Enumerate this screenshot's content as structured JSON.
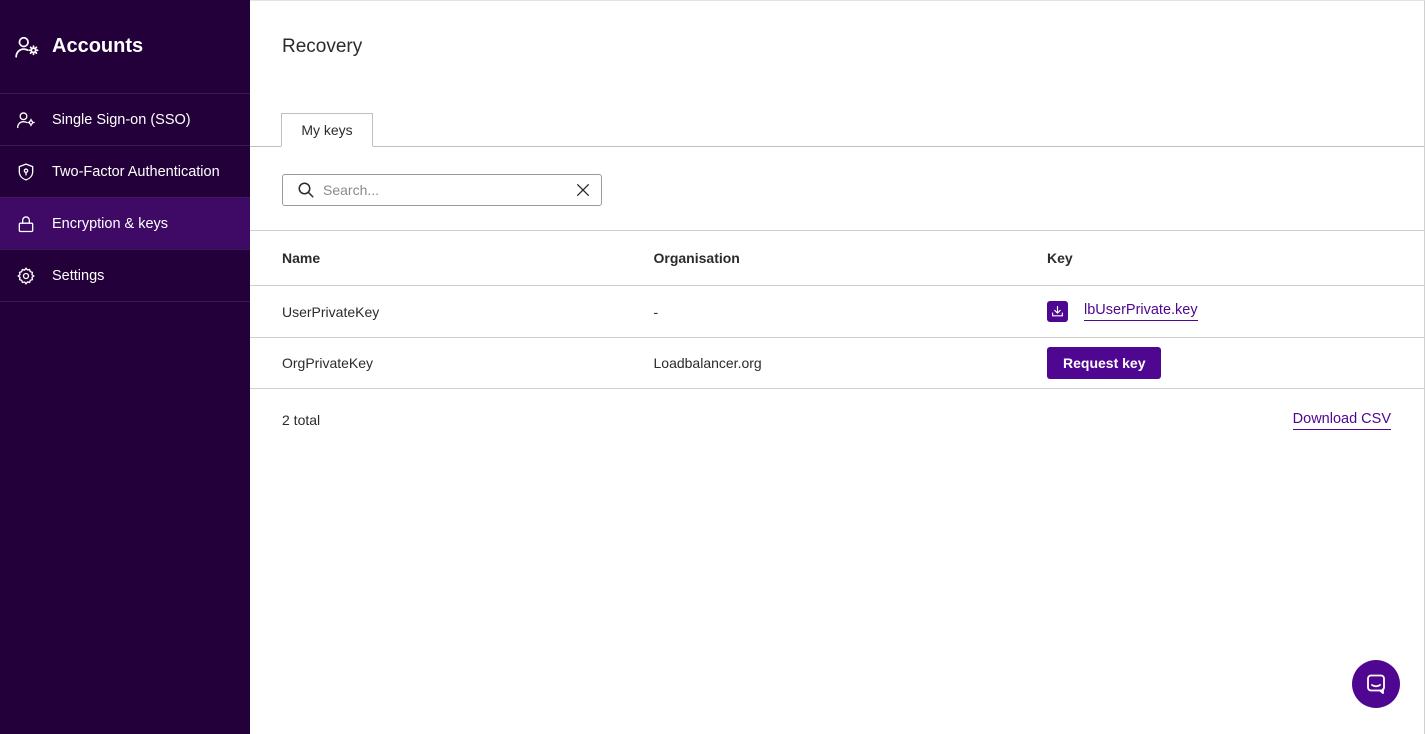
{
  "sidebar": {
    "title": "Accounts",
    "title_icon": "user-cog-icon",
    "items": [
      {
        "label": "Single Sign-on (SSO)",
        "icon": "user-cog-icon",
        "active": false
      },
      {
        "label": "Two-Factor Authentication",
        "icon": "shield-icon",
        "active": false
      },
      {
        "label": "Encryption & keys",
        "icon": "lock-icon",
        "active": true
      },
      {
        "label": "Settings",
        "icon": "gear-icon",
        "active": false
      }
    ]
  },
  "main": {
    "title": "Recovery",
    "tabs": [
      {
        "label": "My keys",
        "active": true
      }
    ],
    "search": {
      "placeholder": "Search...",
      "value": ""
    },
    "table": {
      "headers": [
        "Name",
        "Organisation",
        "Key"
      ],
      "rows": [
        {
          "name": "UserPrivateKey",
          "organisation": "-",
          "key_type": "download",
          "key_label": "lbUserPrivate.key"
        },
        {
          "name": "OrgPrivateKey",
          "organisation": "Loadbalancer.org",
          "key_type": "request",
          "key_label": "Request key"
        }
      ]
    },
    "total": "2 total",
    "download_csv": "Download CSV"
  },
  "colors": {
    "sidebar_bg": "#230039",
    "sidebar_active": "#3f0a66",
    "accent": "#4f0690"
  },
  "chat": {
    "icon": "chat-icon"
  }
}
